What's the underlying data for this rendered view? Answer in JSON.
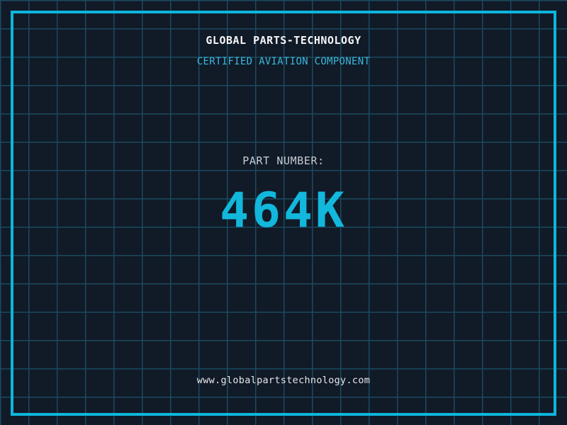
{
  "header": {
    "title": "GLOBAL PARTS-TECHNOLOGY",
    "subtitle": "CERTIFIED AVIATION COMPONENT"
  },
  "part": {
    "label": "PART NUMBER:",
    "number": "464K"
  },
  "footer": {
    "website": "www.globalpartstechnology.com"
  },
  "colors": {
    "background": "#111a27",
    "grid_line": "#1a4a5f",
    "frame_accent": "#0db5dc",
    "part_number_accent": "#12b7dc",
    "subtitle_accent": "#3ab8dc",
    "title_text": "#f5f6f7",
    "label_text": "#c7ccd3",
    "footer_text": "#e7e9eb"
  }
}
